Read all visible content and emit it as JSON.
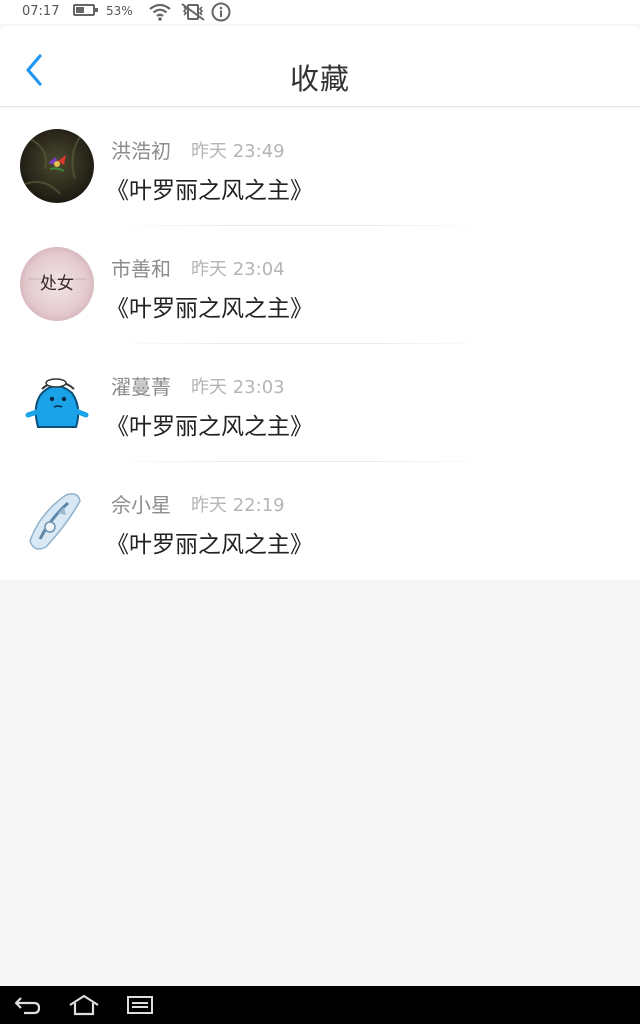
{
  "status_bar": {
    "time": "07:17",
    "battery_percent": "53%",
    "battery_level": 0.53,
    "icons": [
      "battery-icon",
      "wifi-icon",
      "vibrate-mute-icon",
      "info-icon"
    ]
  },
  "header": {
    "title": "收藏",
    "back_icon": "chevron-left-icon",
    "accent_color": "#2196f3"
  },
  "favorites": [
    {
      "user": "洪浩初",
      "time": "昨天 23:49",
      "title": "《叶罗丽之风之主》"
    },
    {
      "user": "市善和",
      "time": "昨天 23:04",
      "title": "《叶罗丽之风之主》",
      "avatar_text": "处女"
    },
    {
      "user": "濯蔓菁",
      "time": "昨天 23:03",
      "title": "《叶罗丽之风之主》"
    },
    {
      "user": "佘小星",
      "time": "昨天 22:19",
      "title": "《叶罗丽之风之主》"
    }
  ],
  "nav_bar": {
    "icons": [
      "back-icon",
      "home-icon",
      "recent-apps-icon"
    ]
  }
}
